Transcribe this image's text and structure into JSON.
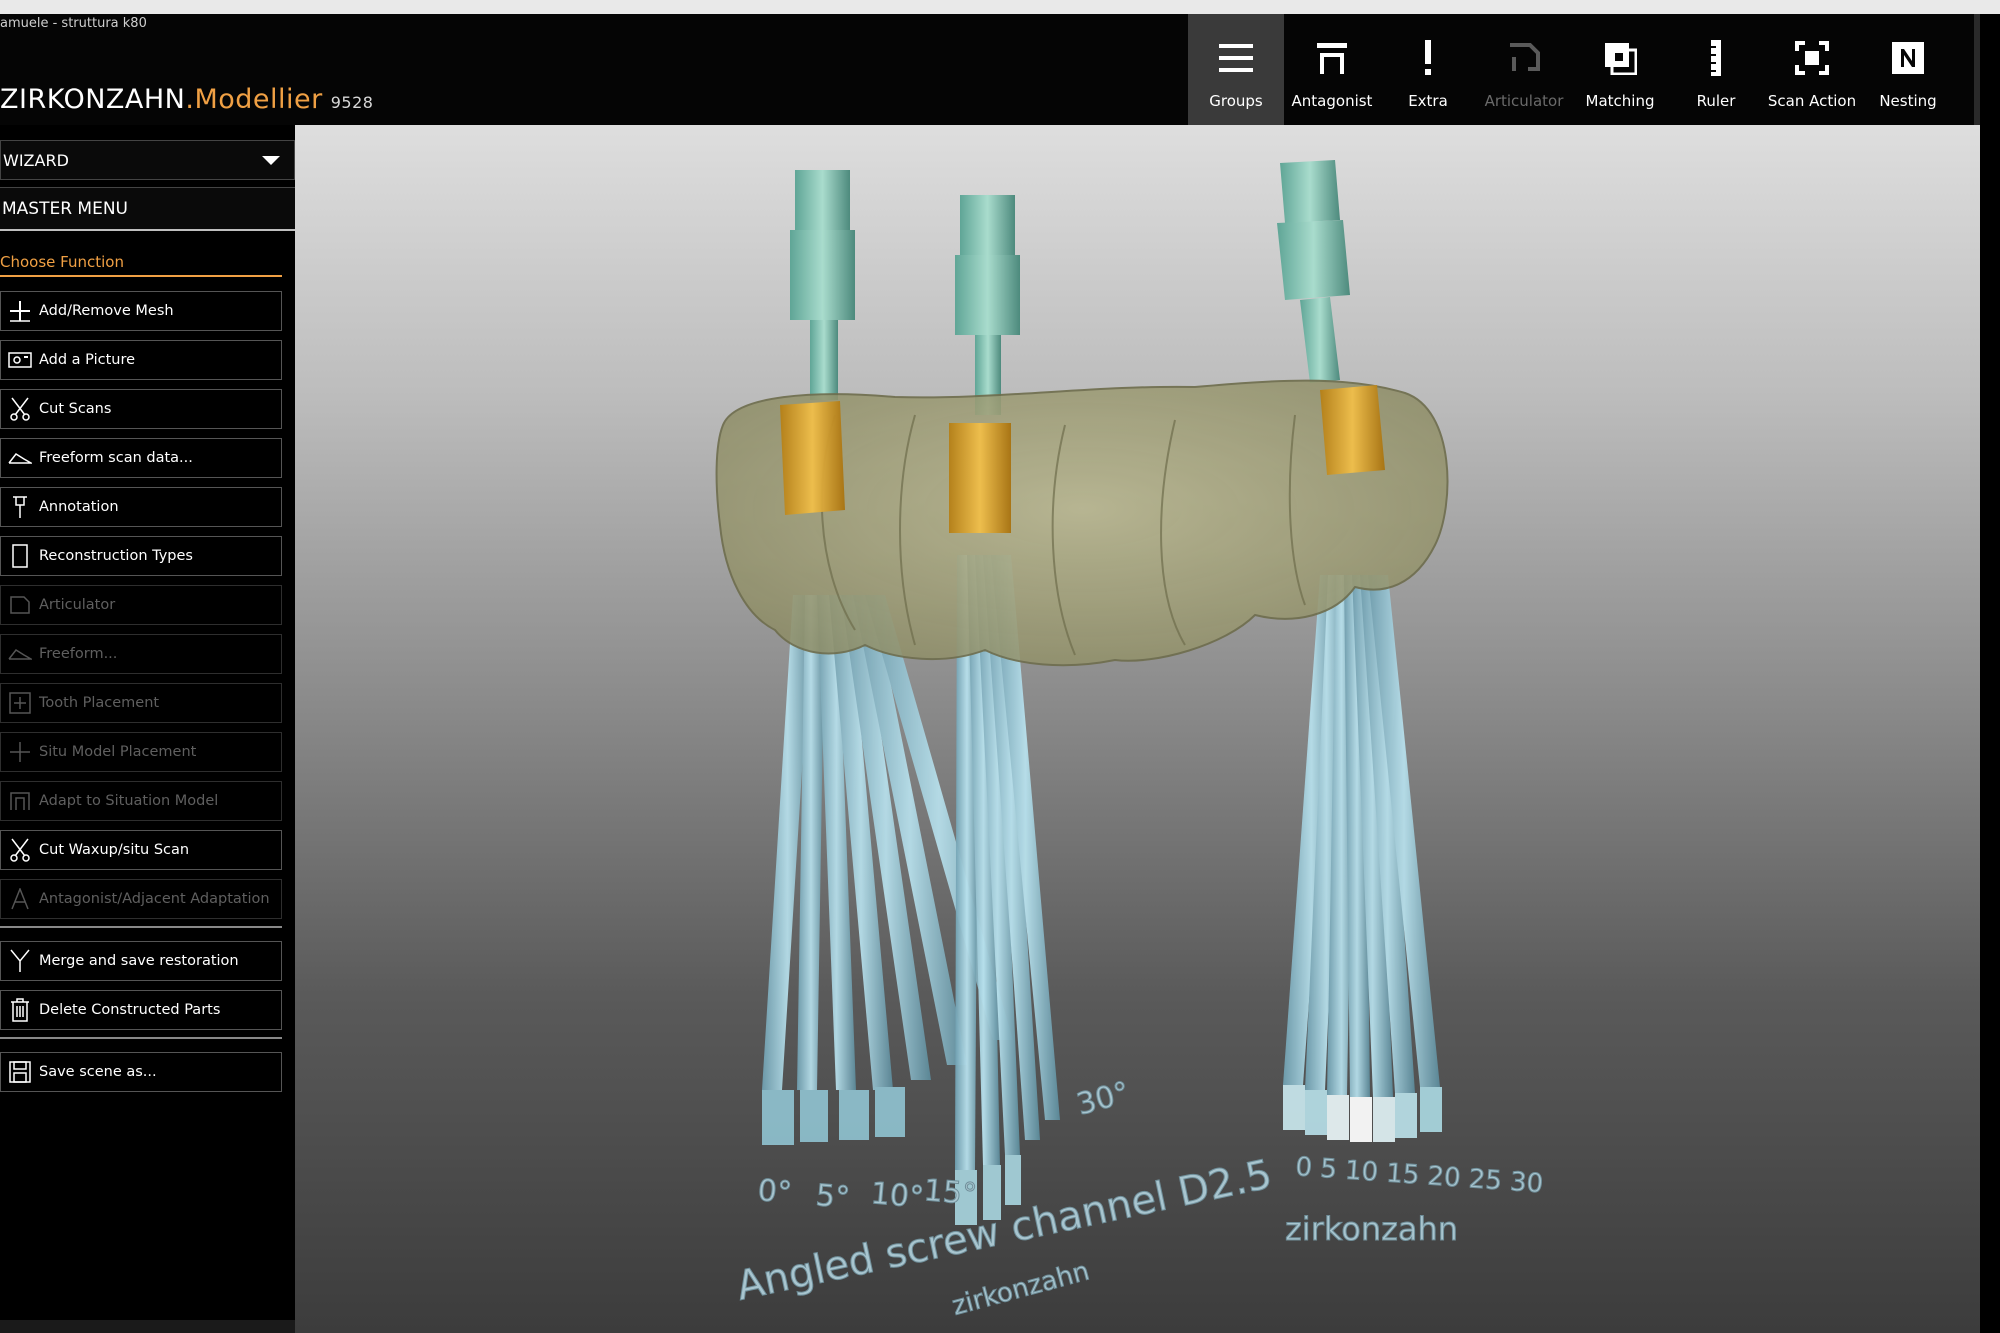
{
  "window": {
    "file_title": "amuele - struttura k80"
  },
  "brand": {
    "main": "ZIRKONZAHN",
    "dot": ".",
    "sub": "Modellier",
    "number": "9528"
  },
  "toolbar": {
    "items": [
      {
        "label": "Groups",
        "icon": "groups-icon",
        "state": "active"
      },
      {
        "label": "Antagonist",
        "icon": "antagonist-icon",
        "state": "normal"
      },
      {
        "label": "Extra",
        "icon": "exclamation-icon",
        "state": "normal"
      },
      {
        "label": "Articulator",
        "icon": "articulator-icon",
        "state": "disabled"
      },
      {
        "label": "Matching",
        "icon": "matching-icon",
        "state": "normal"
      },
      {
        "label": "Ruler",
        "icon": "ruler-icon",
        "state": "normal"
      },
      {
        "label": "Scan Action",
        "icon": "scan-action-icon",
        "state": "normal"
      },
      {
        "label": "Nesting",
        "icon": "nesting-icon",
        "state": "normal"
      }
    ]
  },
  "sidebar": {
    "wizard_label": "WIZARD",
    "master_menu_label": "MASTER MENU",
    "choose_function": "Choose Function",
    "items": [
      {
        "label": "Add/Remove Mesh",
        "icon": "plus-icon",
        "enabled": true
      },
      {
        "label": "Add a Picture",
        "icon": "picture-icon",
        "enabled": true
      },
      {
        "label": "Cut Scans",
        "icon": "scissors-icon",
        "enabled": true
      },
      {
        "label": "Freeform scan data...",
        "icon": "freeform-icon",
        "enabled": true
      },
      {
        "label": "Annotation",
        "icon": "pin-icon",
        "enabled": true
      },
      {
        "label": "Reconstruction Types",
        "icon": "tooth-outline-icon",
        "enabled": true
      },
      {
        "label": "Articulator",
        "icon": "articulator-icon",
        "enabled": false
      },
      {
        "label": "Freeform...",
        "icon": "freeform-icon",
        "enabled": false
      },
      {
        "label": "Tooth Placement",
        "icon": "tooth-placement-icon",
        "enabled": false
      },
      {
        "label": "Situ Model Placement",
        "icon": "move-icon",
        "enabled": false
      },
      {
        "label": "Adapt to Situation Model",
        "icon": "adapt-icon",
        "enabled": false
      },
      {
        "label": "Cut Waxup/situ Scan",
        "icon": "scissors-icon",
        "enabled": true
      },
      {
        "label": "Antagonist/Adjacent Adaptation",
        "icon": "letter-a-icon",
        "enabled": false
      },
      {
        "label": "Merge and save restoration",
        "icon": "merge-icon",
        "enabled": true
      },
      {
        "label": "Delete Constructed Parts",
        "icon": "trash-icon",
        "enabled": true
      },
      {
        "label": "Save scene as...",
        "icon": "save-icon",
        "enabled": true
      }
    ]
  },
  "scene": {
    "angle_labels_left": [
      "0°",
      "5°",
      "10°",
      "15°"
    ],
    "angle_label_right": "30°",
    "right_fan_labels": "0 5 10 15 20 25 30",
    "caption_left": "Angled screw channel D2.5",
    "caption_left_sub": "zirkonzahn",
    "caption_right": "zirkonzahn"
  }
}
